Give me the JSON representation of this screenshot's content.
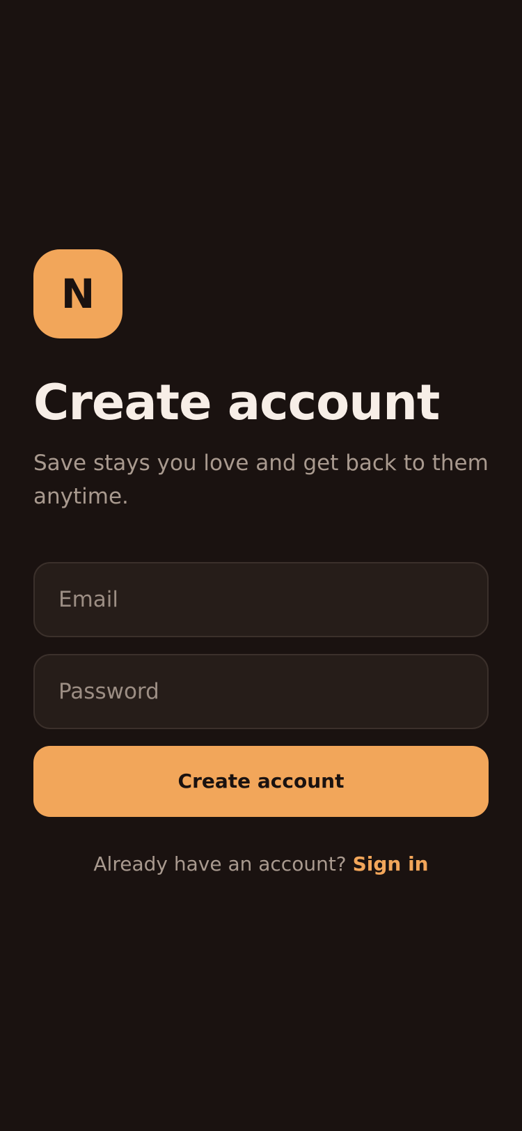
{
  "app": {
    "logo_text": "N"
  },
  "header": {
    "title": "Create account",
    "subtitle": "Save stays you love and get back to them anytime."
  },
  "form": {
    "email": {
      "placeholder": "Email",
      "value": ""
    },
    "password": {
      "placeholder": "Password",
      "value": ""
    },
    "submit_label": "Create account"
  },
  "footer": {
    "prompt_text": "Already have an account?",
    "link_label": "Sign in"
  },
  "colors": {
    "background": "#1a1210",
    "accent": "#f2a65a",
    "title_text": "#f7eee7",
    "muted_text": "#a99a8f",
    "field_background": "#261d19",
    "field_border": "#3b302b"
  }
}
